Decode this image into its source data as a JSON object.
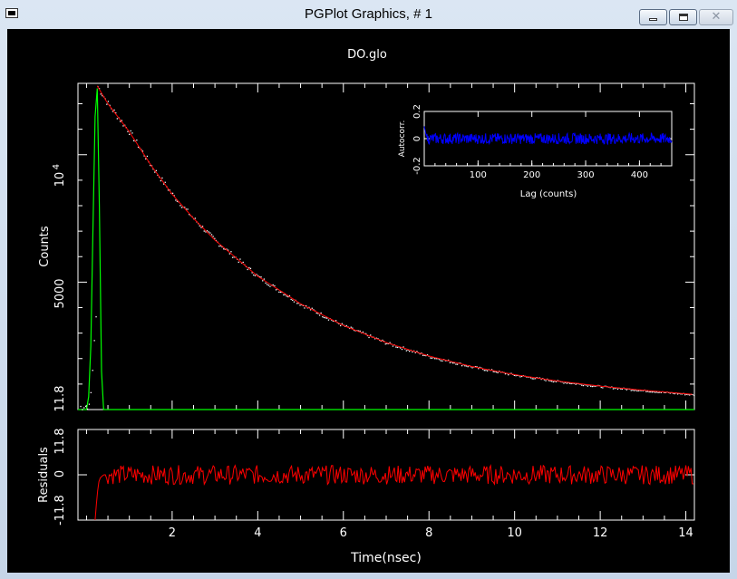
{
  "window": {
    "title": "PGPlot Graphics, # 1",
    "close_glyph": "✕",
    "icons": [
      "app-window-icon",
      "minimize-icon",
      "maximize-icon",
      "close-icon"
    ]
  },
  "colors": {
    "background": "#000000",
    "axes": "#ffffff",
    "data_points": "#ffffff",
    "fit": "#ff0000",
    "irf": "#00ff00",
    "residuals": "#ff0000",
    "autocorrelation": "#0000ff"
  },
  "chart_data": [
    {
      "type": "scatter",
      "title": "DO.glo",
      "ylabel": "Counts",
      "xlim": [
        -0.2,
        14.2
      ],
      "ylim": [
        0,
        12800
      ],
      "yticks": [
        {
          "value": 5000,
          "label": "5000"
        },
        {
          "value": 10000,
          "label": "10"
        }
      ],
      "ytick_exponent_label": "4",
      "grid": false,
      "series": [
        {
          "role": "data",
          "x": [
            0.25,
            0.5,
            1,
            1.5,
            2,
            2.5,
            3,
            4,
            5,
            6,
            7,
            8,
            9,
            10,
            11,
            12,
            13,
            14,
            14.2
          ],
          "y": [
            12700,
            12000,
            10900,
            9600,
            8450,
            7500,
            6650,
            5230,
            4150,
            3300,
            2630,
            2100,
            1690,
            1370,
            1120,
            920,
            760,
            620,
            590
          ]
        },
        {
          "role": "fit",
          "x": [
            0.25,
            0.5,
            1,
            1.5,
            2,
            2.5,
            3,
            4,
            5,
            6,
            7,
            8,
            9,
            10,
            11,
            12,
            13,
            14,
            14.2
          ],
          "y": [
            12700,
            12000,
            10900,
            9600,
            8450,
            7500,
            6650,
            5230,
            4150,
            3300,
            2630,
            2100,
            1690,
            1370,
            1120,
            920,
            760,
            620,
            590
          ]
        },
        {
          "role": "irf",
          "x": [
            -0.2,
            0.0,
            0.05,
            0.1,
            0.15,
            0.2,
            0.25,
            0.3,
            0.35,
            0.4,
            14.2
          ],
          "y": [
            0,
            0,
            500,
            2500,
            7000,
            11500,
            12600,
            8000,
            1500,
            0,
            0
          ]
        }
      ]
    },
    {
      "type": "line",
      "ylabel": "Residuals",
      "xlabel": "Time(nsec)",
      "xlim": [
        -0.2,
        14.2
      ],
      "ylim": [
        -11.8,
        11.8
      ],
      "xticks": [
        2,
        4,
        6,
        8,
        10,
        12,
        14
      ],
      "yticks": [
        {
          "value": -11.8,
          "label": "-11.8"
        },
        {
          "value": 0,
          "label": "0"
        },
        {
          "value": 11.8,
          "label": "11.8"
        }
      ],
      "series": [
        {
          "role": "residuals",
          "noise_amplitude": 2.5,
          "x": [
            0.2,
            0.25,
            0.3,
            0.4,
            14.2
          ],
          "y": [
            -11.8,
            -5,
            -1,
            0,
            0
          ]
        }
      ]
    },
    {
      "type": "line",
      "ylabel": "Autocorr.",
      "xlabel": "Lag (counts)",
      "xlim": [
        0,
        460
      ],
      "ylim": [
        -0.2,
        0.2
      ],
      "xticks": [
        100,
        200,
        300,
        400
      ],
      "yticks": [
        {
          "value": -0.2,
          "label": "-0.2"
        },
        {
          "value": 0,
          "label": "0"
        },
        {
          "value": 0.2,
          "label": "0.2"
        }
      ],
      "series": [
        {
          "role": "autocorrelation",
          "noise_amplitude": 0.04,
          "x": [
            0,
            2,
            5,
            460
          ],
          "y": [
            0.09,
            0.05,
            0,
            0
          ]
        }
      ]
    }
  ]
}
